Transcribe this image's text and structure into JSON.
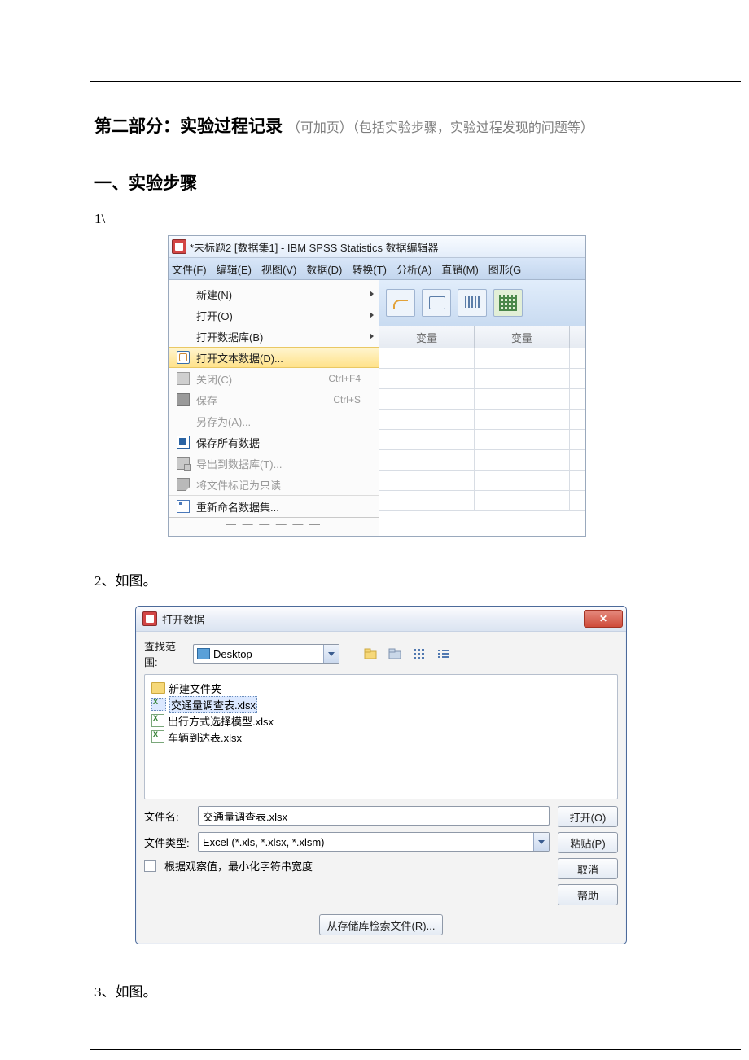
{
  "doc": {
    "section_prefix": "第二部分：实验过程记录",
    "section_sub": "（可加页）（包括实验步骤，实验过程发现的问题等）",
    "heading_steps": "一、实验步骤",
    "step1": "1\\",
    "step2_prefix": "2",
    "step2_suffix": "、如图。",
    "step3_prefix": "3",
    "step3_suffix": "、如图。"
  },
  "spss": {
    "title": "*未标题2 [数据集1] - IBM SPSS Statistics 数据编辑器",
    "menubar": [
      "文件(F)",
      "编辑(E)",
      "视图(V)",
      "数据(D)",
      "转换(T)",
      "分析(A)",
      "直销(M)",
      "图形(G"
    ],
    "menu": {
      "new": "新建(N)",
      "open": "打开(O)",
      "open_db": "打开数据库(B)",
      "open_text": "打开文本数据(D)...",
      "close": "关闭(C)",
      "close_sc": "Ctrl+F4",
      "save": "保存",
      "save_sc": "Ctrl+S",
      "saveas": "另存为(A)...",
      "saveall": "保存所有数据",
      "export_db": "导出到数据库(T)...",
      "mark_ro": "将文件标记为只读",
      "rename_ds": "重新命名数据集..."
    },
    "col_header": "变量"
  },
  "dlg": {
    "title": "打开数据",
    "close_x": "✕",
    "lookin_label": "查找范围:",
    "lookin_value": "Desktop",
    "files": {
      "folder": "新建文件夹",
      "f1": "交通量调查表.xlsx",
      "f2": "出行方式选择模型.xlsx",
      "f3": "车辆到达表.xlsx"
    },
    "filename_label": "文件名:",
    "filename_value": "交通量调查表.xlsx",
    "filetype_label": "文件类型:",
    "filetype_value": "Excel (*.xls, *.xlsx, *.xlsm)",
    "min_width": "根据观察值，最小化字符串宽度",
    "btn_open": "打开(O)",
    "btn_paste": "粘贴(P)",
    "btn_cancel": "取消",
    "btn_help": "帮助",
    "btn_retrieve": "从存储库检索文件(R)..."
  }
}
